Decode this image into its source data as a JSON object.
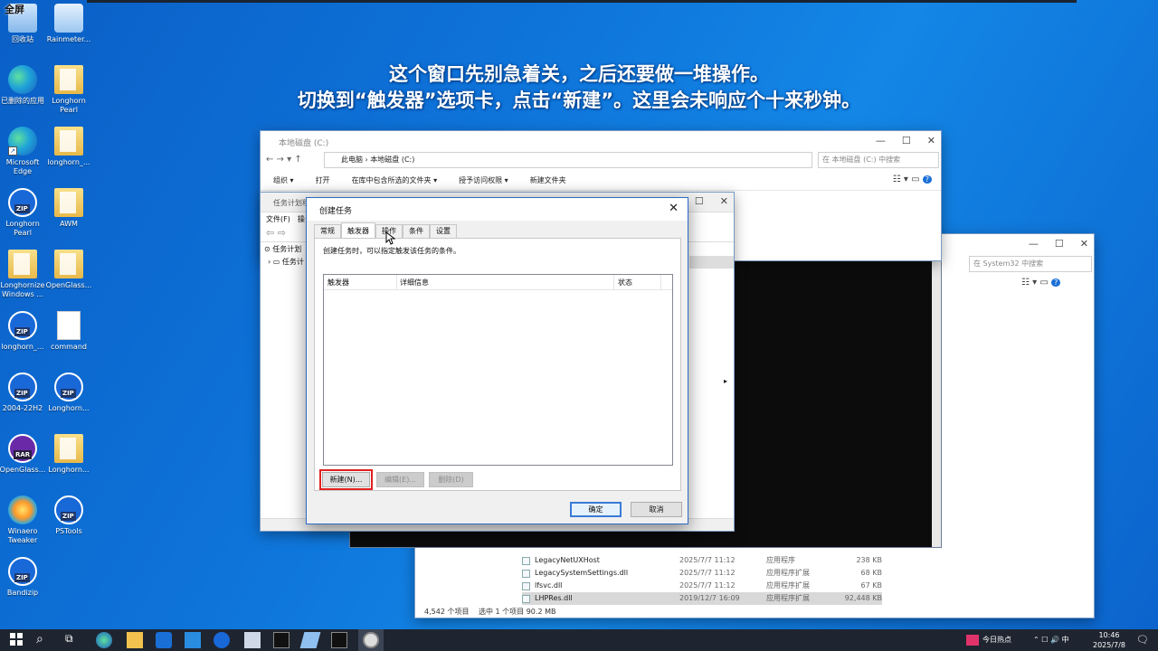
{
  "caption": {
    "line1": "这个窗口先别急着关，之后还要做一堆操作。",
    "line2": "切换到“触发器”选项卡，点击“新建”。这里会未响应个十来秒钟。"
  },
  "desktop_icons": [
    {
      "label": "回收站",
      "extra": "全屏"
    },
    {
      "label": "Rainmeter..."
    },
    {
      "label": "已删除的应用"
    },
    {
      "label": "Longhorn Pearl"
    },
    {
      "label": "Microsoft Edge"
    },
    {
      "label": "longhorn_..."
    },
    {
      "label": "Longhorn Pearl"
    },
    {
      "label": "AWM"
    },
    {
      "label": "Longhornize Windows ..."
    },
    {
      "label": "OpenGlass..."
    },
    {
      "label": "longhorn_..."
    },
    {
      "label": "command"
    },
    {
      "label": "2004-22H2"
    },
    {
      "label": "Longhorn..."
    },
    {
      "label": "OpenGlass..."
    },
    {
      "label": "Longhorn..."
    },
    {
      "label": "Winaero Tweaker"
    },
    {
      "label": "PSTools"
    },
    {
      "label": "Bandizip"
    }
  ],
  "explorer_c": {
    "title": "本地磁盘 (C:)",
    "breadcrumb": [
      "此电脑",
      "本地磁盘 (C:)"
    ],
    "search_placeholder": "在 本地磁盘 (C:) 中搜索",
    "toolbar": [
      "组织 ▾",
      "打开",
      "在库中包含所选的文件夹 ▾",
      "授予访问权限 ▾",
      "新建文件夹"
    ]
  },
  "explorer_sys32": {
    "search_placeholder": "在 System32 中搜索",
    "files": [
      {
        "name": "LegacyNetUXHost",
        "date": "2025/7/7 11:12",
        "type": "应用程序",
        "size": "238 KB"
      },
      {
        "name": "LegacySystemSettings.dll",
        "date": "2025/7/7 11:12",
        "type": "应用程序扩展",
        "size": "68 KB"
      },
      {
        "name": "lfsvc.dll",
        "date": "2025/7/7 11:12",
        "type": "应用程序扩展",
        "size": "67 KB"
      },
      {
        "name": "LHPRes.dll",
        "date": "2019/12/7 16:09",
        "type": "应用程序扩展",
        "size": "92,448 KB"
      }
    ],
    "status": {
      "count": "4,542 个项目",
      "selected": "选中 1 个项目 90.2 MB"
    }
  },
  "task_scheduler": {
    "title": "任务计划程序",
    "menu": [
      "文件(F)",
      "操"
    ],
    "tree": [
      "任务计划",
      "任务计"
    ]
  },
  "dialog": {
    "title": "创建任务",
    "tabs": [
      "常规",
      "触发器",
      "操作",
      "条件",
      "设置"
    ],
    "active_tab": "触发器",
    "description": "创建任务时，可以指定触发该任务的条件。",
    "columns": [
      "触发器",
      "详细信息",
      "状态"
    ],
    "buttons": {
      "new": "新建(N)...",
      "edit": "编辑(E)...",
      "delete": "删除(D)",
      "ok": "确定",
      "cancel": "取消"
    }
  },
  "taskbar": {
    "news": "今日热点",
    "ime": "中",
    "time": "10:46",
    "date": "2025/7/8"
  },
  "colors": {
    "accent": "#0078d7",
    "highlight": "#e02020"
  }
}
